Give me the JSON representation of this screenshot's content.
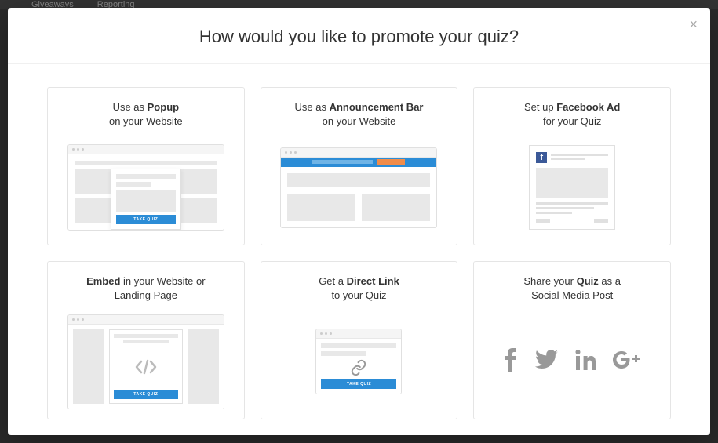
{
  "nav": {
    "item1": "Giveaways",
    "item2": "Reporting"
  },
  "modal": {
    "title": "How would you like to promote your quiz?",
    "close": "×"
  },
  "cards": {
    "popup": {
      "prefix": "Use as ",
      "bold": "Popup",
      "line2": "on your Website",
      "cta": "TAKE QUIZ"
    },
    "announcement": {
      "prefix": "Use as ",
      "bold": "Announcement Bar",
      "line2": "on your Website"
    },
    "facebook": {
      "prefix": "Set up ",
      "bold": "Facebook Ad",
      "line2": "for your Quiz",
      "fb_letter": "f"
    },
    "embed": {
      "bold": "Embed",
      "suffix": " in your Website or",
      "line2": "Landing Page",
      "cta": "TAKE QUIZ"
    },
    "directlink": {
      "prefix": "Get a ",
      "bold": "Direct Link",
      "line2": "to your Quiz",
      "cta": "TAKE QUIZ"
    },
    "social": {
      "prefix": "Share your ",
      "bold": "Quiz",
      "suffix": " as a",
      "line2": "Social Media Post"
    }
  }
}
